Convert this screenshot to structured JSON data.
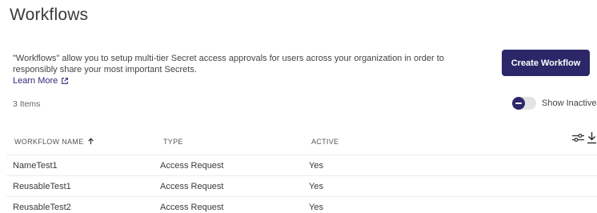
{
  "page": {
    "title": "Workflows"
  },
  "intro": {
    "description": "\"Workflows\" allow you to setup multi-tier Secret access approvals for users across your organization in order to responsibly share your most important Secrets.",
    "learn_more": "Learn More"
  },
  "actions": {
    "create_label": "Create Workflow"
  },
  "list_meta": {
    "count": "3 Items",
    "show_inactive_label": "Show Inactive",
    "show_inactive_on": false
  },
  "table": {
    "columns": {
      "name": "WORKFLOW NAME",
      "type": "TYPE",
      "active": "ACTIVE"
    },
    "sort_icon": "arrow-up-icon",
    "tool_icons": [
      "filter-sliders-icon",
      "download-icon"
    ],
    "rows": [
      {
        "name": "NameTest1",
        "type": "Access Request",
        "active": "Yes"
      },
      {
        "name": "ReusableTest1",
        "type": "Access Request",
        "active": "Yes"
      },
      {
        "name": "ReusableTest2",
        "type": "Access Request",
        "active": "Yes"
      }
    ]
  },
  "colors": {
    "primary": "#2b2768",
    "link": "#2f2b7a"
  }
}
